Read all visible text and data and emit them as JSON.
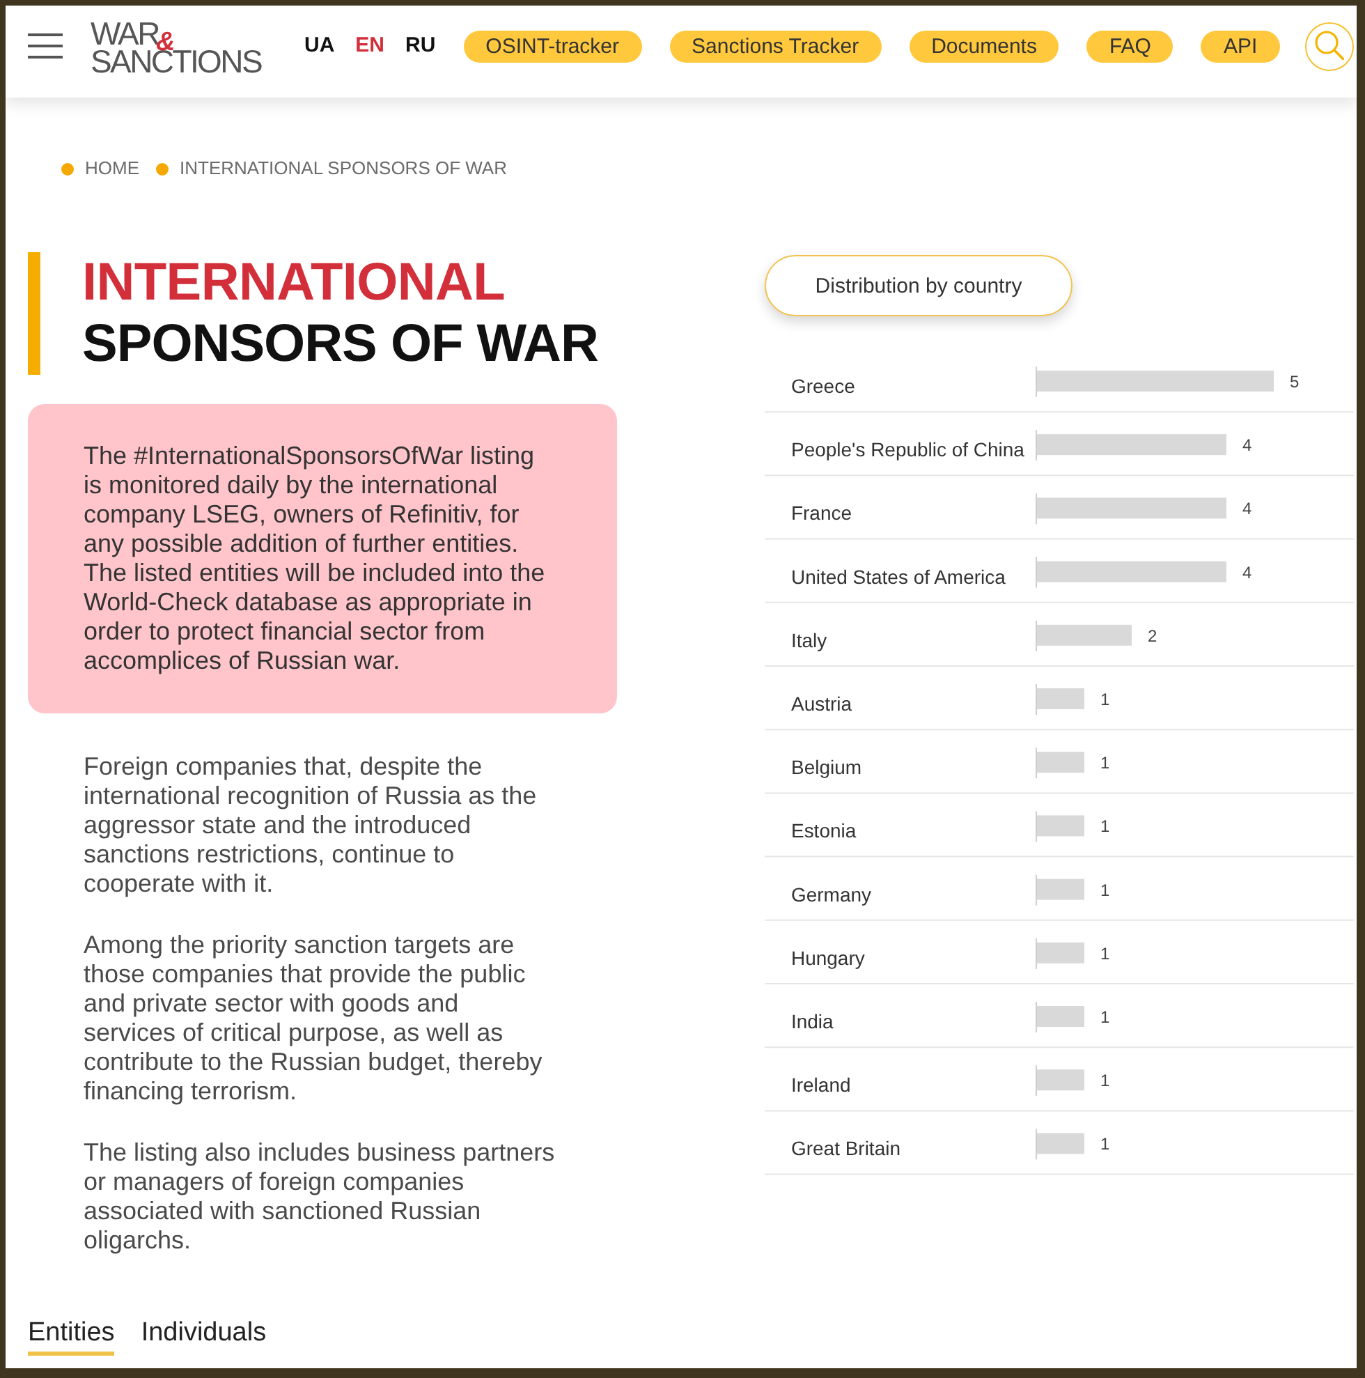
{
  "header": {
    "logo": {
      "line_1": "WAR",
      "ampersand": "&",
      "line_2": "SANCTIONS"
    },
    "languages": [
      {
        "label": "UA",
        "selected": false
      },
      {
        "label": "EN",
        "selected": true
      },
      {
        "label": "RU",
        "selected": false
      }
    ],
    "nav": [
      "OSINT-tracker",
      "Sanctions Tracker",
      "Documents",
      "FAQ",
      "API"
    ]
  },
  "breadcrumb": [
    "HOME",
    "INTERNATIONAL SPONSORS OF WAR"
  ],
  "title": {
    "line_1": "INTERNATIONAL",
    "line_2": "SPONSORS OF WAR"
  },
  "notice": "The #InternationalSponsorsOfWar listing is monitored daily by the international company LSEG, owners of Refinitiv, for any possible addition of further entities. The listed entities will be included into the World-Check database as appropriate in order to protect financial sector from accomplices of Russian war.",
  "paragraphs": [
    "Foreign companies that, despite the international recognition of Russia as the aggressor state and the introduced sanctions restrictions, continue to cooperate with it.",
    "Among the priority sanction targets are those companies that provide the public and private sector with goods and services of critical purpose, as well as contribute to the Russian budget, thereby financing terrorism.",
    "The listing also includes business partners or managers of foreign companies associated with sanctioned Russian oligarchs."
  ],
  "tabs": [
    {
      "label": "Entities",
      "selected": true
    },
    {
      "label": "Individuals",
      "selected": false
    }
  ],
  "distribution": {
    "button": "Distribution by country",
    "chart_data": {
      "type": "bar",
      "orientation": "horizontal",
      "categories": [
        "Greece",
        "People's Republic of China",
        "France",
        "United States of America",
        "Italy",
        "Austria",
        "Belgium",
        "Estonia",
        "Germany",
        "Hungary",
        "India",
        "Ireland",
        "Great Britain"
      ],
      "values": [
        5,
        4,
        4,
        4,
        2,
        1,
        1,
        1,
        1,
        1,
        1,
        1,
        1
      ],
      "xlim": [
        0,
        5
      ],
      "data_labels": true
    }
  }
}
